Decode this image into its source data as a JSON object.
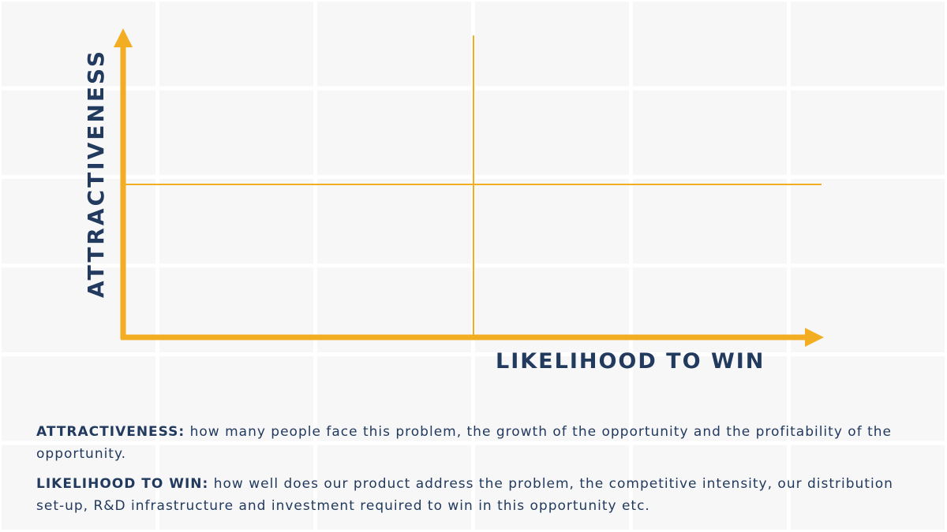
{
  "diagram": {
    "y_axis_label": "ATTRACTIVENESS",
    "x_axis_label": "LIKELIHOOD TO WIN",
    "accent_color": "#f2ad22",
    "text_color": "#213a5e"
  },
  "definitions": [
    {
      "term": "ATTRACTIVENESS:",
      "text": "how many people face this problem, the growth of the opportunity and the profitability of the opportunity."
    },
    {
      "term": "LIKELIHOOD TO WIN:",
      "text": "how well does our product address the problem, the competitive intensity, our distribution set-up, R&D infrastructure and investment required to win in this opportunity etc."
    }
  ]
}
